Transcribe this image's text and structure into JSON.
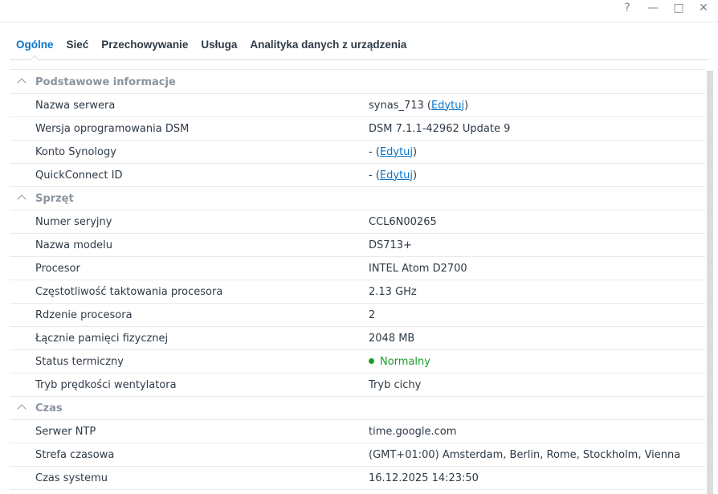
{
  "window": {
    "help": "?",
    "minimize": "—",
    "maximize": "□",
    "close": "✕"
  },
  "tabs": [
    "Ogólne",
    "Sieć",
    "Przechowywanie",
    "Usługa",
    "Analityka danych z urządzenia"
  ],
  "sections": [
    {
      "title": "Podstawowe informacje",
      "rows": [
        {
          "label": "Nazwa serwera",
          "prefix": "synas_713 (",
          "link": "Edytuj",
          "suffix": ")"
        },
        {
          "label": "Wersja oprogramowania DSM",
          "prefix": "DSM 7.1.1-42962 Update 9"
        },
        {
          "label": "Konto Synology",
          "prefix": "- (",
          "link": "Edytuj",
          "suffix": ")"
        },
        {
          "label": "QuickConnect ID",
          "prefix": "- (",
          "link": "Edytuj",
          "suffix": ")"
        }
      ]
    },
    {
      "title": "Sprzęt",
      "rows": [
        {
          "label": "Numer seryjny",
          "prefix": "CCL6N00265"
        },
        {
          "label": "Nazwa modelu",
          "prefix": "DS713+"
        },
        {
          "label": "Procesor",
          "prefix": "INTEL Atom D2700"
        },
        {
          "label": "Częstotliwość taktowania procesora",
          "prefix": "2.13 GHz"
        },
        {
          "label": "Rdzenie procesora",
          "prefix": "2"
        },
        {
          "label": "Łącznie pamięci fizycznej",
          "prefix": "2048 MB"
        },
        {
          "label": "Status termiczny",
          "status": "Normalny"
        },
        {
          "label": "Tryb prędkości wentylatora",
          "prefix": "Tryb cichy"
        }
      ]
    },
    {
      "title": "Czas",
      "rows": [
        {
          "label": "Serwer NTP",
          "prefix": "time.google.com"
        },
        {
          "label": "Strefa czasowa",
          "prefix": "(GMT+01:00) Amsterdam, Berlin, Rome, Stockholm, Vienna"
        },
        {
          "label": "Czas systemu",
          "prefix": "16.12.2025 14:23:50"
        }
      ]
    }
  ],
  "colors": {
    "accent": "#0a74c6",
    "status_ok": "#1d9a2c"
  }
}
